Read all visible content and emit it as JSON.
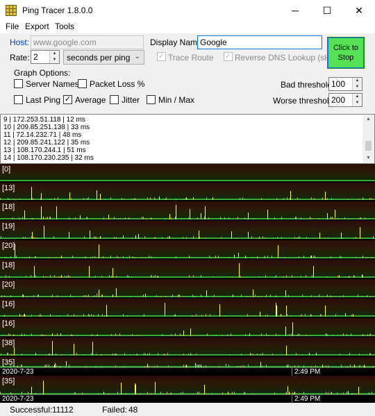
{
  "window": {
    "title": "Ping Tracer 1.8.0.0",
    "minimize_glyph": "─",
    "maximize_glyph": "☐",
    "close_glyph": "✕"
  },
  "menu": [
    "File",
    "Export",
    "Tools"
  ],
  "form": {
    "host_label": "Host:",
    "host_value": "www.google.com",
    "display_name_label": "Display Name:",
    "display_name_value": "Google",
    "rate_label": "Rate:",
    "rate_value": "2",
    "rate_unit": "seconds per ping",
    "trace_route_label": "Trace Route",
    "trace_route_checked": true,
    "reverse_dns_label": "Reverse DNS Lookup (slow)",
    "reverse_dns_checked": true,
    "stop_button": "Click to Stop",
    "graph_options_label": "Graph Options:",
    "server_names_label": "Server Names",
    "packet_loss_label": "Packet Loss %",
    "last_ping_label": "Last Ping",
    "average_label": "Average",
    "jitter_label": "Jitter",
    "minmax_label": "Min / Max",
    "server_names_checked": false,
    "packet_loss_checked": false,
    "last_ping_checked": false,
    "average_checked": true,
    "jitter_checked": false,
    "minmax_checked": false,
    "bad_threshold_label": "Bad threshold:",
    "bad_threshold_value": "100",
    "worse_threshold_label": "Worse threshold:",
    "worse_threshold_value": "200"
  },
  "log_lines": [
    "9 | 172.253.51.118 | 12 ms",
    "10 | 209.85.251.138 | 33 ms",
    "11 | 72.14.232.71 | 48 ms",
    "12 | 209.85.241.122 | 35 ms",
    "13 | 108.170.244.1 | 51 ms",
    "14 | 108.170.230.235 | 32 ms"
  ],
  "graphs": [
    {
      "label": "[0]"
    },
    {
      "label": "[13]"
    },
    {
      "label": "[18]"
    },
    {
      "label": "[19]"
    },
    {
      "label": "[20]"
    },
    {
      "label": "[18]"
    },
    {
      "label": "[20]"
    },
    {
      "label": "[16]"
    },
    {
      "label": "[16]"
    },
    {
      "label": "[38]"
    },
    {
      "label": "[35]"
    },
    {
      "label": "[35]"
    }
  ],
  "axis": {
    "date": "2020-7-23",
    "time": "2:49 PM"
  },
  "status": {
    "successful_label": "Successful:",
    "successful_value": "11112",
    "failed_label": "Failed:",
    "failed_value": "48"
  },
  "colors": {
    "stop_button": "#55e055",
    "spike": "#ffff55",
    "baseline": "#3aaa3a",
    "host_label": "#0044cc"
  }
}
